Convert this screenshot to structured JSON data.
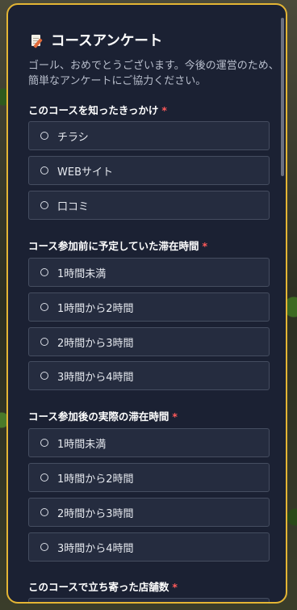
{
  "survey": {
    "title": "コースアンケート",
    "subtitle": "ゴール、おめでとうございます。今後の運営のため、簡単なアンケートにご協力ください。",
    "required_mark": "*",
    "questions": [
      {
        "label": "このコースを知ったきっかけ",
        "options": [
          "チラシ",
          "WEBサイト",
          "口コミ"
        ]
      },
      {
        "label": "コース参加前に予定していた滞在時間",
        "options": [
          "1時間未満",
          "1時間から2時間",
          "2時間から3時間",
          "3時間から4時間"
        ]
      },
      {
        "label": "コース参加後の実際の滞在時間",
        "options": [
          "1時間未満",
          "1時間から2時間",
          "2時間から3時間",
          "3時間から4時間"
        ]
      },
      {
        "label": "このコースで立ち寄った店舗数",
        "options": []
      }
    ]
  },
  "colors": {
    "panel_bg": "#1b2133",
    "border_accent": "#e4b534",
    "required": "#ff5a5a"
  },
  "icons": {
    "title_icon": "memo-icon"
  }
}
